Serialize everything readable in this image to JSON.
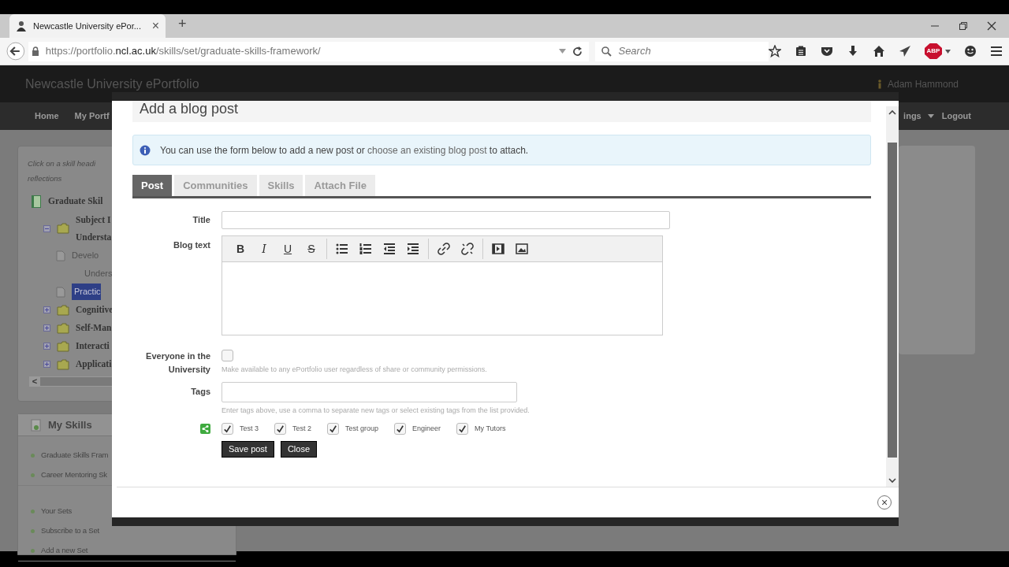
{
  "browser": {
    "tab_title": "Newcastle University ePor...",
    "tab_close": "×",
    "new_tab": "+",
    "url": "https://portfolio.**ncl.ac.uk**/skills/set/graduate-skills-framework/",
    "search_placeholder": "Search",
    "adblock_label": "ABP"
  },
  "site": {
    "title": "Newcastle University ePortfolio",
    "user": "Adam Hammond",
    "nav_left": [
      {
        "label": "Home",
        "dropdown": false
      },
      {
        "label": "My Portf",
        "dropdown": false
      }
    ],
    "nav_right": [
      {
        "label": "ings",
        "dropdown": true
      },
      {
        "label": "Logout",
        "dropdown": false
      }
    ]
  },
  "sidebar": {
    "hint_lines": [
      "Click on a skill headi",
      "reflections"
    ],
    "tree": [
      {
        "kind": "set",
        "label": "Graduate Skil",
        "selected": false,
        "children": [
          {
            "kind": "folder",
            "label": "Subject I",
            "label_continued": "Understa",
            "expanded": true,
            "selected": false,
            "children": [
              {
                "kind": "page",
                "label": "Develo",
                "selected": false
              },
              {
                "kind": "text",
                "label": "Unders",
                "selected": false
              },
              {
                "kind": "page",
                "label": "Practic",
                "selected": true
              }
            ]
          },
          {
            "kind": "folder",
            "label": "Cognitive",
            "expanded": false,
            "selected": false
          },
          {
            "kind": "folder",
            "label": "Self-Man",
            "expanded": false,
            "selected": false
          },
          {
            "kind": "folder",
            "label": "Interacti",
            "expanded": false,
            "selected": false
          },
          {
            "kind": "folder",
            "label": "Applicati",
            "expanded": false,
            "selected": false
          }
        ]
      }
    ],
    "scroll_left": "<"
  },
  "my_skills": {
    "title": "My Skills",
    "groups": [
      [
        "Graduate Skills Fram",
        "Career Mentoring Sk"
      ],
      [
        "Your Sets",
        "Subscribe to a Set",
        "Add a new Set"
      ]
    ]
  },
  "modal": {
    "title": "Add a blog post",
    "info": {
      "before": "You can use the form below to add a new post or ",
      "link": "choose an existing blog post",
      "after": " to attach."
    },
    "tabs": [
      {
        "label": "Post",
        "selected": true
      },
      {
        "label": "Communities",
        "selected": false
      },
      {
        "label": "Skills",
        "selected": false
      },
      {
        "label": "Attach File",
        "selected": false
      }
    ],
    "title_label": "Title",
    "blog_label": "Blog text",
    "toolbar": [
      [
        {
          "kind": "bold",
          "label": "B"
        },
        {
          "kind": "italic",
          "label": "I"
        },
        {
          "kind": "underline",
          "label": "U"
        },
        {
          "kind": "strike",
          "label": "S"
        }
      ],
      [
        {
          "kind": "bullets"
        },
        {
          "kind": "numbers"
        },
        {
          "kind": "outdent"
        },
        {
          "kind": "indent"
        }
      ],
      [
        {
          "kind": "link"
        },
        {
          "kind": "unlink"
        }
      ],
      [
        {
          "kind": "media"
        },
        {
          "kind": "image"
        }
      ]
    ],
    "everyone": {
      "label": "Everyone in the University",
      "checked": false,
      "help": "Make available to any ePortfolio user regardless of share or community permissions."
    },
    "tags": {
      "label": "Tags",
      "help": "Enter tags above, use a comma to separate new tags or select existing tags from the list provided."
    },
    "communities": [
      {
        "label": "Test 3",
        "checked": true
      },
      {
        "label": "Test 2",
        "checked": true
      },
      {
        "label": "Test group",
        "checked": true
      },
      {
        "label": "Engineer",
        "checked": true
      },
      {
        "label": "My Tutors",
        "checked": true
      }
    ],
    "buttons": [
      "Save post",
      "Close"
    ],
    "close_symbol": "×"
  }
}
